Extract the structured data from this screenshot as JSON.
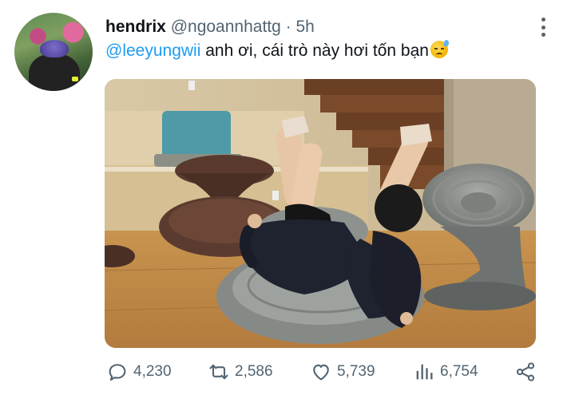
{
  "tweet": {
    "author_name": "hendrix",
    "handle": "@ngoannhattg",
    "separator": "·",
    "time": "5h",
    "mention": "@leeyungwii",
    "body": " anh ơi, cái trò này hơi tốn bạn"
  },
  "actions": {
    "reply_count": "4,230",
    "retweet_count": "2,586",
    "like_count": "5,739",
    "views_count": "6,754"
  },
  "icons": {
    "emoji": "anxious-face-with-sweat-emoji",
    "more": "more-vertical-icon",
    "reply": "reply-icon",
    "retweet": "retweet-icon",
    "like": "heart-icon",
    "views": "views-icon",
    "share": "share-icon"
  },
  "colors": {
    "link": "#1d9bf0",
    "secondary_text": "#536471",
    "primary_text": "#0f1419"
  }
}
